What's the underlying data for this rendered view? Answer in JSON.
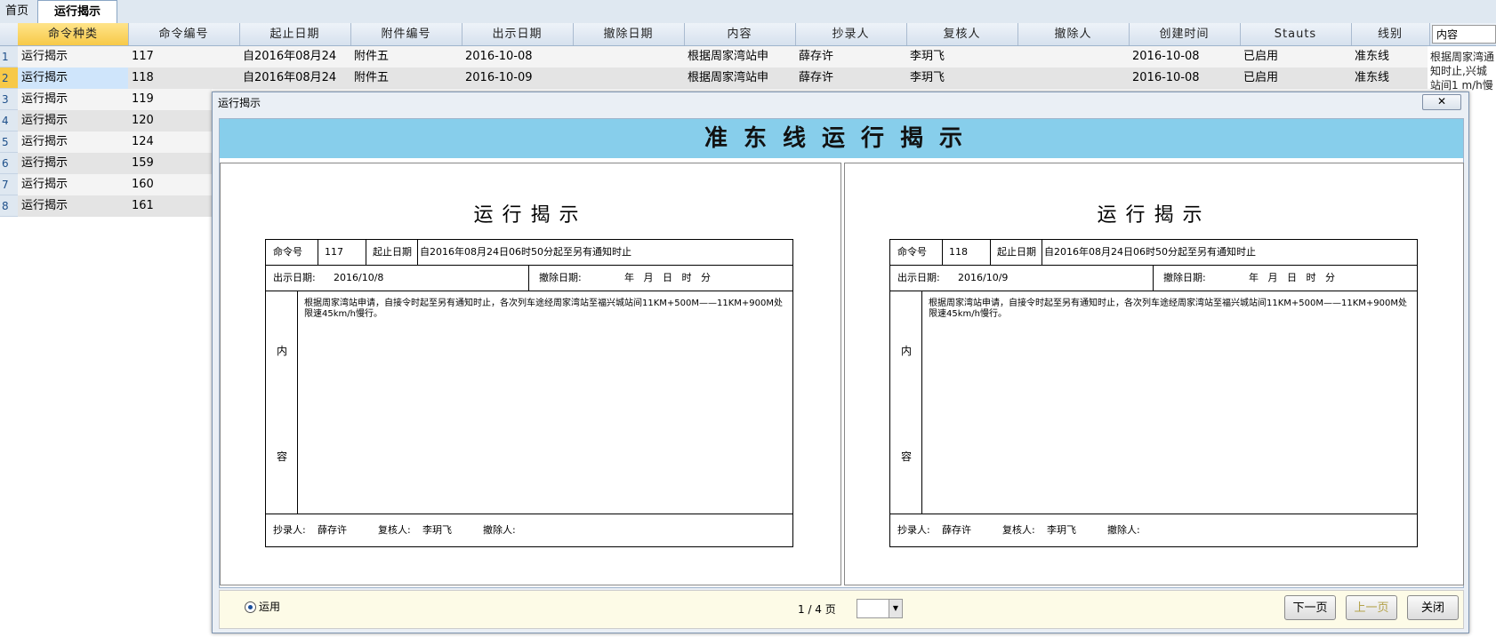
{
  "tabs": [
    "首页",
    "运行揭示"
  ],
  "grid": {
    "columns": [
      "命令种类",
      "命令编号",
      "起止日期",
      "附件编号",
      "出示日期",
      "撤除日期",
      "内容",
      "抄录人",
      "复核人",
      "撤除人",
      "创建时间",
      "Stauts",
      "线别"
    ],
    "filter_value": "内容",
    "right_text": "根据周家湾通知时止,兴城站间1 m/h慢",
    "rows": [
      {
        "n": "1",
        "type": "运行揭示",
        "id": "117",
        "range": "自2016年08月24",
        "att": "附件五",
        "show": "2016-10-08",
        "content": "根据周家湾站申",
        "copy": "薛存许",
        "check": "李玥飞",
        "created": "2016-10-08",
        "status": "已启用",
        "line": "准东线"
      },
      {
        "n": "2",
        "type": "运行揭示",
        "id": "118",
        "range": "自2016年08月24",
        "att": "附件五",
        "show": "2016-10-09",
        "content": "根据周家湾站申",
        "copy": "薛存许",
        "check": "李玥飞",
        "created": "2016-10-08",
        "status": "已启用",
        "line": "准东线"
      },
      {
        "n": "3",
        "type": "运行揭示",
        "id": "119"
      },
      {
        "n": "4",
        "type": "运行揭示",
        "id": "120"
      },
      {
        "n": "5",
        "type": "运行揭示",
        "id": "124"
      },
      {
        "n": "6",
        "type": "运行揭示",
        "id": "159"
      },
      {
        "n": "7",
        "type": "运行揭示",
        "id": "160"
      },
      {
        "n": "8",
        "type": "运行揭示",
        "id": "161"
      }
    ]
  },
  "dialog": {
    "title": "运行揭示",
    "close": "✕",
    "banner": "准东线运行揭示",
    "pages": [
      {
        "title": "运行揭示",
        "cmd_label": "命令号",
        "cmd": "117",
        "range_label": "起止日期",
        "range": "自2016年08月24日06时50分起至另有通知时止",
        "show_label": "出示日期:",
        "show": "2016/10/8",
        "remove_label": "撤除日期:",
        "remove_fmt": "年   月   日   时   分",
        "side1": "内",
        "side2": "容",
        "content": "根据周家湾站申请，自接令时起至另有通知时止，各次列车途经周家湾站至福兴城站间11KM+500M——11KM+900M处限速45km/h慢行。",
        "copy_label": "抄录人:",
        "copy": "薛存许",
        "check_label": "复核人:",
        "check": "李玥飞",
        "remover_label": "撤除人:"
      },
      {
        "title": "运行揭示",
        "cmd_label": "命令号",
        "cmd": "118",
        "range_label": "起止日期",
        "range": "自2016年08月24日06时50分起至另有通知时止",
        "show_label": "出示日期:",
        "show": "2016/10/9",
        "remove_label": "撤除日期:",
        "remove_fmt": "年   月   日   时   分",
        "side1": "内",
        "side2": "容",
        "content": "根据周家湾站申请，自接令时起至另有通知时止，各次列车途经周家湾站至福兴城站间11KM+500M——11KM+900M处限速45km/h慢行。",
        "copy_label": "抄录人:",
        "copy": "薛存许",
        "check_label": "复核人:",
        "check": "李玥飞",
        "remover_label": "撤除人:"
      }
    ],
    "radio_label": "运用",
    "pager": "1 / 4 页",
    "next": "下一页",
    "prev": "上一页",
    "close_btn": "关闭"
  }
}
